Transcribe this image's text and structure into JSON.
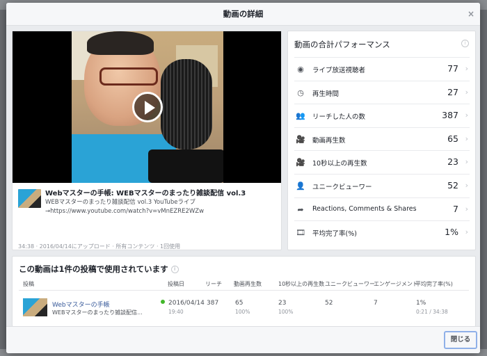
{
  "modal": {
    "title": "動画の詳細",
    "close_x": "×"
  },
  "video": {
    "title": "Webマスターの手帳: WEBマスターのまったり雑談配信 vol.3",
    "description": "WEBマスターのまったり雑談配信 vol.3 YouTubeライブ →https://www.youtube.com/watch?v=vMnEZRE2WZw",
    "meta": "34:38 · 2016/04/14にアップロード · 所有コンテンツ · 1回使用"
  },
  "performance": {
    "title": "動画の合計パフォーマンス",
    "rows": [
      {
        "icon": "eye-icon",
        "glyph": "◉",
        "label": "ライブ放送視聴者",
        "value": "77"
      },
      {
        "icon": "clock-icon",
        "glyph": "◷",
        "label": "再生時間",
        "value": "27"
      },
      {
        "icon": "people-icon",
        "glyph": "👥",
        "label": "リーチした人の数",
        "value": "387"
      },
      {
        "icon": "video-camera-icon",
        "glyph": "🎥",
        "label": "動画再生数",
        "value": "65"
      },
      {
        "icon": "video-camera-icon",
        "glyph": "🎥",
        "label": "10秒以上の再生数",
        "value": "23"
      },
      {
        "icon": "person-icon",
        "glyph": "👤",
        "label": "ユニークビューワー",
        "value": "52"
      },
      {
        "icon": "share-arrow-icon",
        "glyph": "➦",
        "label": "Reactions, Comments & Shares",
        "value": "7"
      },
      {
        "icon": "film-icon",
        "glyph": "🎞",
        "label": "平均完了率(%)",
        "value": "1%"
      }
    ]
  },
  "posts": {
    "title": "この動画は1件の投稿で使用されています",
    "headers": [
      "投稿",
      "投稿日",
      "リーチ",
      "動画再生数",
      "10秒以上の再生数",
      "ユニークビューワー",
      "エンゲージメント",
      "平均完了率(%)"
    ],
    "row": {
      "name": "Webマスターの手帳",
      "subtitle": "WEBマスターのまったり雑談配信...",
      "date": "2016/04/14",
      "time": "19:40",
      "reach": "387",
      "views": "65",
      "views_pct": "100%",
      "views10": "23",
      "views10_pct": "100%",
      "unique": "52",
      "engagement": "7",
      "completion": "1%",
      "completion_detail": "0:21 / 34:38"
    }
  },
  "footer": {
    "close_label": "閉じる"
  }
}
